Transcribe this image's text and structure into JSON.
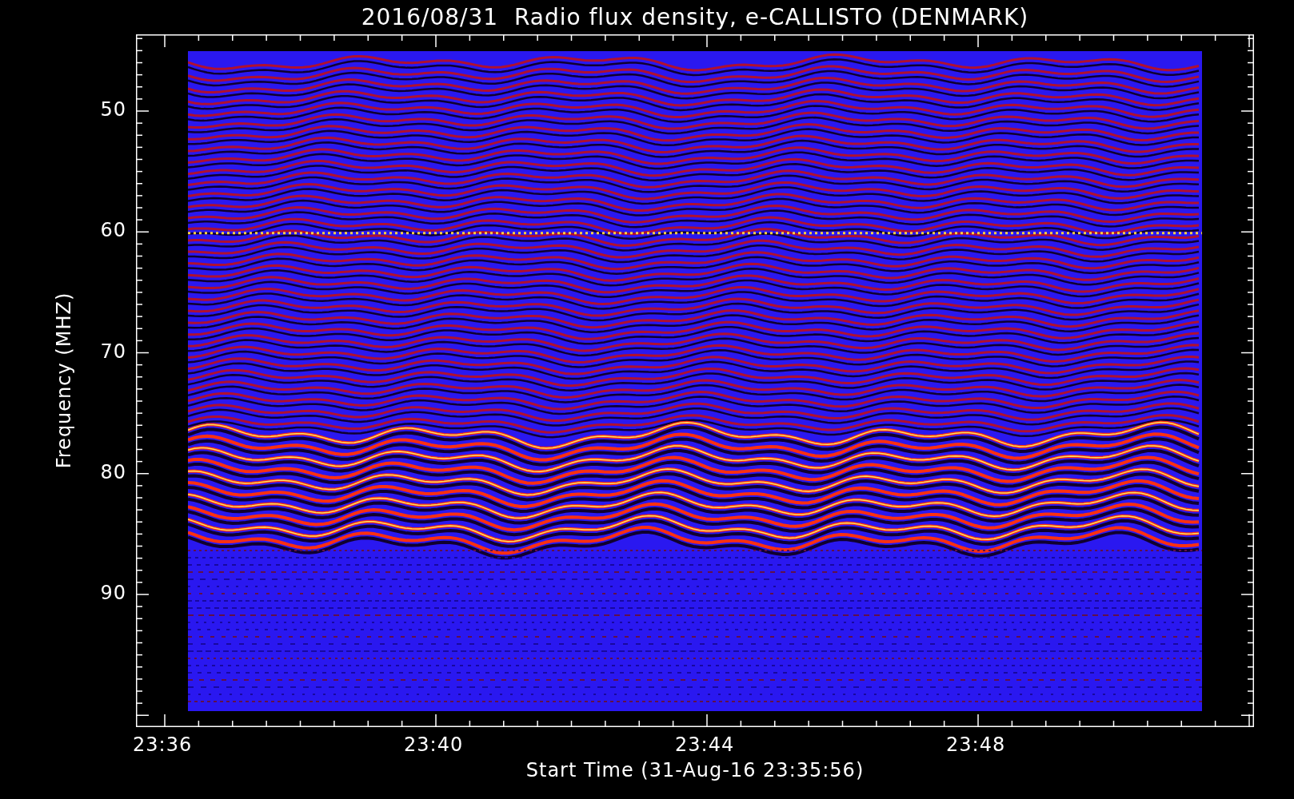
{
  "title": "2016/08/31  Radio flux density, e-CALLISTO (DENMARK)",
  "y_axis": {
    "label": "Frequency (MHZ)",
    "ticks": [
      "50",
      "60",
      "70",
      "80",
      "90"
    ]
  },
  "x_axis": {
    "label": "Start Time (31-Aug-16 23:35:56)",
    "ticks": [
      "23:36",
      "23:40",
      "23:44",
      "23:48"
    ]
  }
}
